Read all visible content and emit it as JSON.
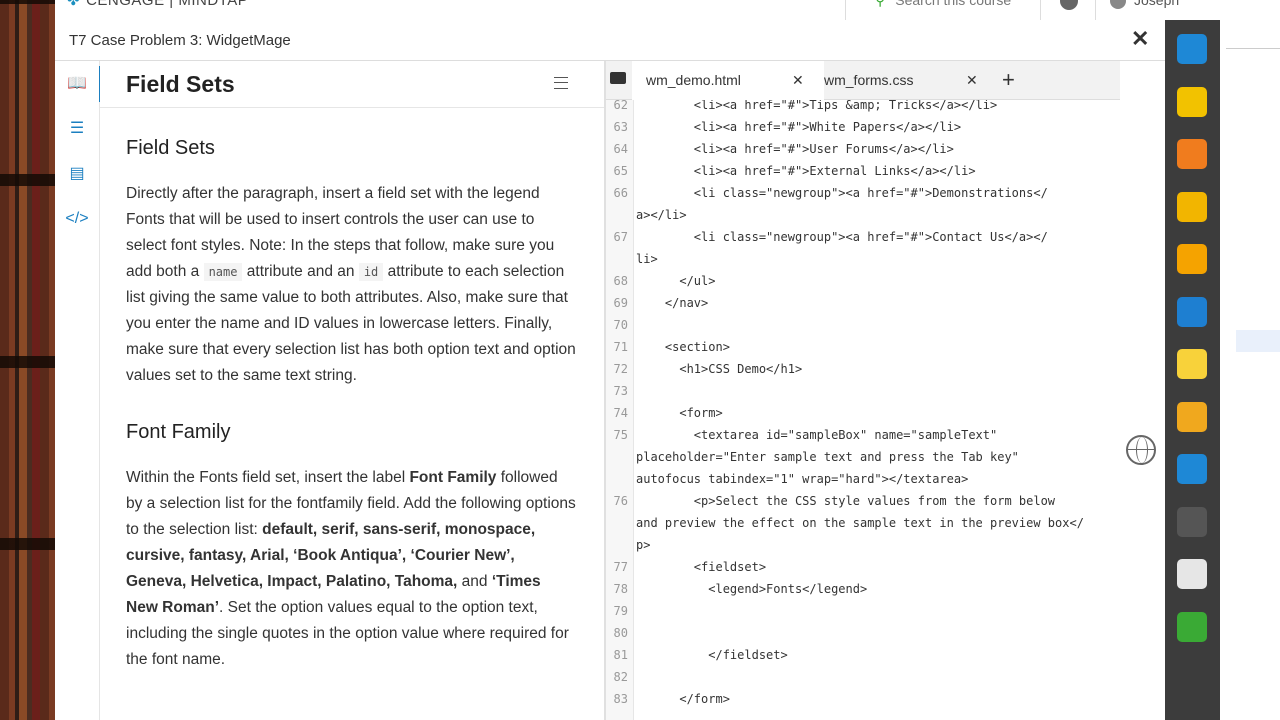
{
  "brand": {
    "logo": "✤",
    "name": "CENGAGE | MINDTAP"
  },
  "topbar": {
    "search_placeholder": "Search this course",
    "user": "Joseph"
  },
  "window": {
    "title": "T7 Case Problem 3: WidgetMage",
    "close": "✕"
  },
  "rail": {
    "items": [
      "book-icon",
      "tasks-icon",
      "chart-icon",
      "code-icon"
    ]
  },
  "instructions": {
    "title": "Field Sets",
    "h_fieldsets": "Field Sets",
    "p1_a": "Directly after the paragraph, insert a field set with the legend Fonts that will be used to insert controls the user can use to select font styles. Note: In the steps that follow, make sure you add both a ",
    "p1_code1": "name",
    "p1_b": " attribute and an ",
    "p1_code2": "id",
    "p1_c": " attribute to each selection list giving the same value to both attributes. Also, make sure that you enter the name and ID values in lowercase letters. Finally, make sure that every selection list has both option text and option values set to the same text string.",
    "h_fontfamily": "Font Family",
    "p2_a": "Within the Fonts field set, insert the label ",
    "p2_b1": "Font Family",
    "p2_c": " followed by a selection list for the fontfamily field. Add the following options to the selection list: ",
    "p2_b2": "default, serif, sans-serif, monospace, cursive, fantasy, Arial, ‘Book Antiqua’, ‘Courier New’, Geneva, Helvetica, Impact, Palatino, Tahoma,",
    "p2_d": " and ",
    "p2_b3": "‘Times New Roman’",
    "p2_e": ". Set the option values equal to the option text, including the single quotes in the option value where required for the font name."
  },
  "editor": {
    "tabs": [
      {
        "label": "wm_demo.html",
        "active": true
      },
      {
        "label": "wm_forms.css",
        "active": false
      }
    ],
    "tab_close": "✕",
    "add_tab": "+",
    "lines": [
      {
        "n": "62",
        "t": "        <li><a href=\"#\">Tips &amp; Tricks</a></li>"
      },
      {
        "n": "63",
        "t": "        <li><a href=\"#\">White Papers</a></li>"
      },
      {
        "n": "64",
        "t": "        <li><a href=\"#\">User Forums</a></li>"
      },
      {
        "n": "65",
        "t": "        <li><a href=\"#\">External Links</a></li>"
      },
      {
        "n": "66",
        "t": "        <li class=\"newgroup\"><a href=\"#\">Demonstrations</"
      },
      {
        "n": "",
        "t": "a></li>"
      },
      {
        "n": "67",
        "t": "        <li class=\"newgroup\"><a href=\"#\">Contact Us</a></"
      },
      {
        "n": "",
        "t": "li>"
      },
      {
        "n": "68",
        "t": "      </ul>"
      },
      {
        "n": "69",
        "t": "    </nav>"
      },
      {
        "n": "70",
        "t": ""
      },
      {
        "n": "71",
        "t": "    <section>"
      },
      {
        "n": "72",
        "t": "      <h1>CSS Demo</h1>"
      },
      {
        "n": "73",
        "t": ""
      },
      {
        "n": "74",
        "t": "      <form>"
      },
      {
        "n": "75",
        "t": "        <textarea id=\"sampleBox\" name=\"sampleText\""
      },
      {
        "n": "",
        "t": "placeholder=\"Enter sample text and press the Tab key\""
      },
      {
        "n": "",
        "t": "autofocus tabindex=\"1\" wrap=\"hard\"></textarea>"
      },
      {
        "n": "76",
        "t": "        <p>Select the CSS style values from the form below"
      },
      {
        "n": "",
        "t": "and preview the effect on the sample text in the preview box</"
      },
      {
        "n": "",
        "t": "p>"
      },
      {
        "n": "77",
        "t": "        <fieldset>"
      },
      {
        "n": "78",
        "t": "          <legend>Fonts</legend>"
      },
      {
        "n": "79",
        "t": ""
      },
      {
        "n": "80",
        "t": ""
      },
      {
        "n": "81",
        "t": "          </fieldset>"
      },
      {
        "n": "82",
        "t": ""
      },
      {
        "n": "83",
        "t": "      </form>"
      }
    ]
  },
  "dock": {
    "items": [
      {
        "name": "briefcase-icon",
        "color": "#1e88d6"
      },
      {
        "name": "pencil-icon",
        "color": "#f2c200"
      },
      {
        "name": "rss-icon",
        "color": "#f07c1e"
      },
      {
        "name": "az-dictionary-icon",
        "color": "#f2b500"
      },
      {
        "name": "bibliography-icon",
        "color": "#f5a300"
      },
      {
        "name": "ebook-icon",
        "color": "#1e7fd1"
      },
      {
        "name": "notes-icon",
        "color": "#f8d23a"
      },
      {
        "name": "readspeaker-icon",
        "color": "#f0a81e"
      },
      {
        "name": "cnow-icon",
        "color": "#1e88d6"
      },
      {
        "name": "search-q-icon",
        "color": "#555555"
      },
      {
        "name": "notebook-icon",
        "color": "#e6e6e6"
      },
      {
        "name": "profile-icon",
        "color": "#3aaa35"
      }
    ]
  }
}
